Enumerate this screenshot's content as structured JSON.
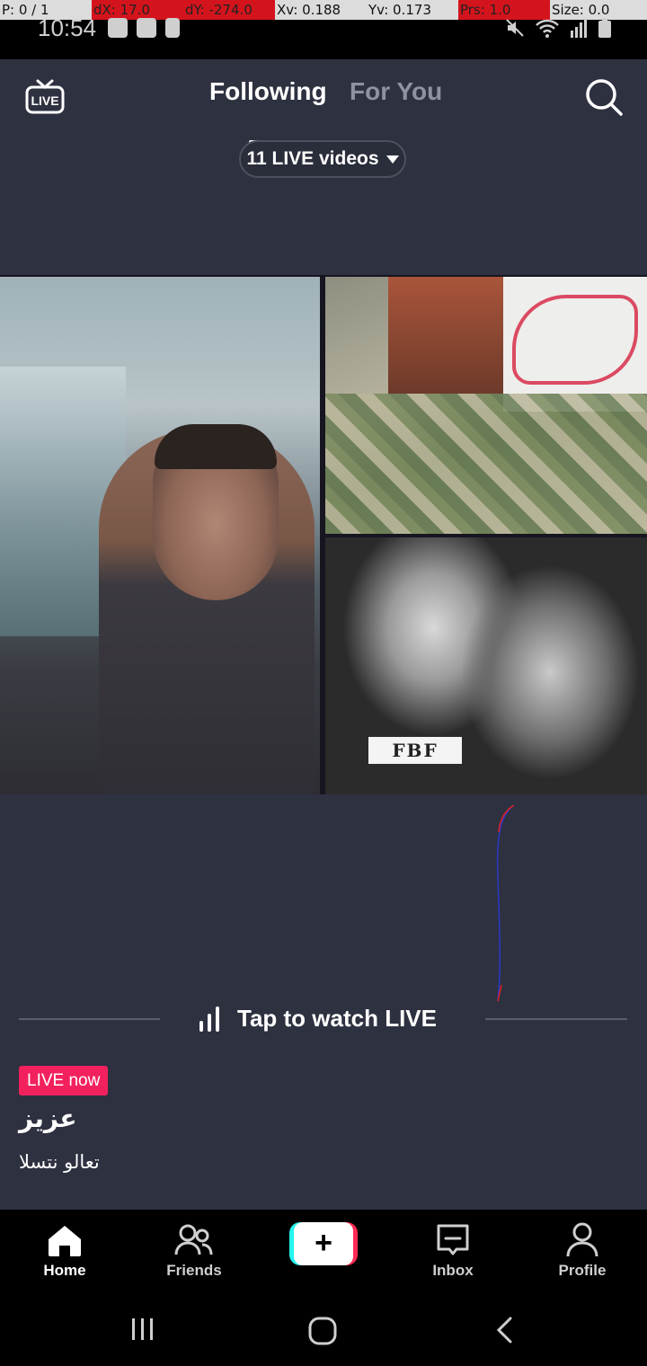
{
  "debug_overlay": {
    "pointer": "P: 0 / 1",
    "dx": "dX: 17.0",
    "dy": "dY: -274.0",
    "xv": "Xv: 0.188",
    "yv": "Yv: 0.173",
    "prs": "Prs: 1.0",
    "size": "Size: 0.0"
  },
  "status_bar": {
    "time": "10:54",
    "icons_left": [
      "notification-icon",
      "app-icon",
      "battery-saver-icon"
    ],
    "icons_right": [
      "mute-icon",
      "wifi-icon",
      "signal-icon",
      "battery-icon"
    ]
  },
  "header": {
    "live_icon_label": "LIVE",
    "tabs": [
      {
        "label": "Following",
        "active": true
      },
      {
        "label": "For You",
        "active": false
      }
    ],
    "search_icon": "search-icon"
  },
  "live_selector": {
    "label": "11 LIVE videos"
  },
  "video_grid": {
    "tiles": [
      {
        "name": "main-host-stream"
      },
      {
        "name": "guest-stream-top"
      },
      {
        "name": "guest-stream-bottom",
        "overlay_text": "FBF"
      }
    ]
  },
  "watch_prompt": {
    "label": "Tap to watch LIVE"
  },
  "stream_info": {
    "badge": "LIVE now",
    "username": "عزيز",
    "caption": "تعالو نتسلا"
  },
  "bottom_nav": {
    "items": [
      {
        "label": "Home",
        "icon": "home-icon",
        "active": true
      },
      {
        "label": "Friends",
        "icon": "friends-icon",
        "active": false
      },
      {
        "label": "",
        "icon": "plus-icon",
        "active": false
      },
      {
        "label": "Inbox",
        "icon": "inbox-icon",
        "active": false
      },
      {
        "label": "Profile",
        "icon": "profile-icon",
        "active": false
      }
    ]
  },
  "colors": {
    "background": "#2e3140",
    "accent_live": "#f2215e",
    "create_cyan": "#25f4ee",
    "create_red": "#fe2c55"
  }
}
